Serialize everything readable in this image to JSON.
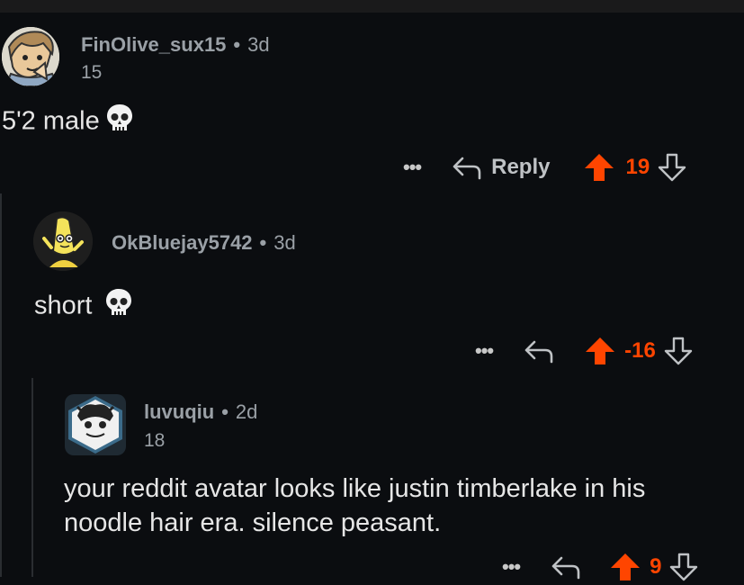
{
  "comments": [
    {
      "username": "FinOlive_sux15",
      "separator": "•",
      "time": "3d",
      "flair": "15",
      "body": "5'2 male",
      "vote_count": "19",
      "reply_label": "Reply",
      "more_label": "•••"
    },
    {
      "username": "OkBluejay5742",
      "separator": "•",
      "time": "3d",
      "flair": "",
      "body": "short",
      "vote_count": "-16",
      "more_label": "•••"
    },
    {
      "username": "luvuqiu",
      "separator": "•",
      "time": "2d",
      "flair": "18",
      "body_lines": [
        "your reddit avatar looks like justin timberlake in his",
        "noodle hair era. silence peasant."
      ],
      "vote_count": "9",
      "more_label": "•••"
    }
  ],
  "icons": {
    "skull": "skull-emoji",
    "reply": "reply-arrow-icon",
    "upvote": "upvote-arrow-icon",
    "downvote": "downvote-arrow-icon",
    "more": "more-options-icon"
  },
  "colors": {
    "background": "#0b0d10",
    "upvote_active": "#ff4500",
    "text": "#e6e6e6",
    "muted": "#9aa0a6"
  }
}
